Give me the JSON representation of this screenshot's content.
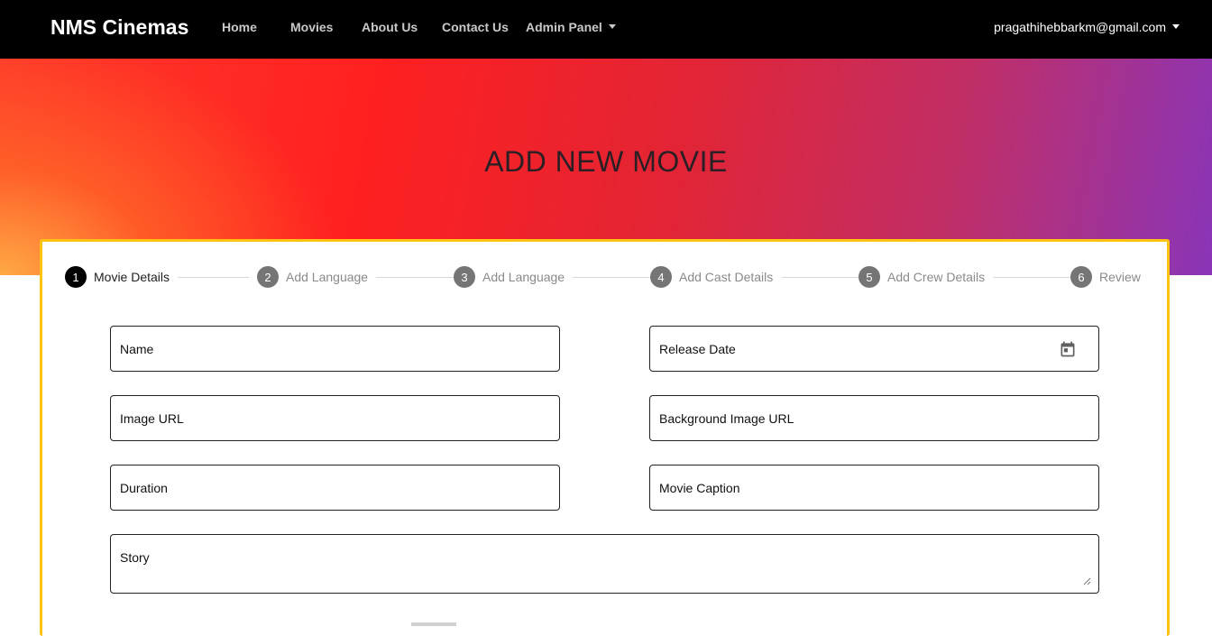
{
  "navbar": {
    "brand": "NMS Cinemas",
    "links": [
      "Home",
      "Movies",
      "About Us",
      "Contact Us"
    ],
    "admin_panel": "Admin Panel",
    "user_email": "pragathihebbarkm@gmail.com"
  },
  "hero": {
    "title": "ADD NEW MOVIE"
  },
  "stepper": {
    "steps": [
      {
        "number": "1",
        "label": "Movie Details",
        "active": true
      },
      {
        "number": "2",
        "label": "Add Language",
        "active": false
      },
      {
        "number": "3",
        "label": "Add Language",
        "active": false
      },
      {
        "number": "4",
        "label": "Add Cast Details",
        "active": false
      },
      {
        "number": "5",
        "label": "Add Crew Details",
        "active": false
      },
      {
        "number": "6",
        "label": "Review",
        "active": false
      }
    ]
  },
  "form": {
    "name": "Name",
    "release_date": "Release Date",
    "image_url": "Image URL",
    "background_image_url": "Background Image URL",
    "duration": "Duration",
    "movie_caption": "Movie Caption",
    "story": "Story"
  },
  "colors": {
    "navbar_bg": "#000000",
    "card_border": "#fcc313",
    "active_step": "#000000",
    "inactive_step": "#757575"
  }
}
